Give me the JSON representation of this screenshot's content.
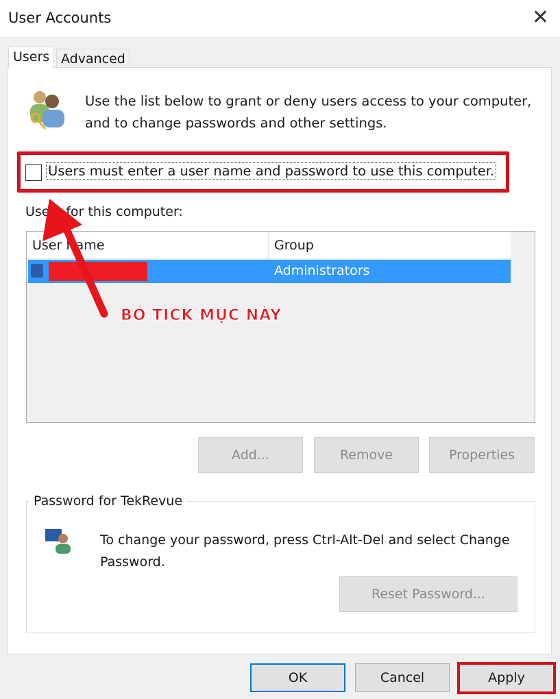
{
  "window": {
    "title": "User Accounts",
    "close_icon": "close-icon"
  },
  "tabs": [
    {
      "label": "Users",
      "active": true
    },
    {
      "label": "Advanced",
      "active": false
    }
  ],
  "intro": {
    "icon": "users-key-icon",
    "text": "Use the list below to grant or deny users access to your computer, and to change passwords and other settings."
  },
  "require_login": {
    "label": "Users must enter a user name and password to use this computer.",
    "checked": false
  },
  "users_list": {
    "label": "Users for this computer:",
    "columns": [
      "User Name",
      "Group"
    ],
    "rows": [
      {
        "name": "",
        "group": "Administrators",
        "selected": true
      }
    ]
  },
  "buttons": {
    "add": "Add...",
    "remove": "Remove",
    "properties": "Properties"
  },
  "password_group": {
    "title": "Password for TekRevue",
    "text": "To change your password, press Ctrl-Alt-Del and select Change Password.",
    "reset": "Reset Password..."
  },
  "footer": {
    "ok": "OK",
    "cancel": "Cancel",
    "apply": "Apply"
  },
  "annotation": {
    "text": "BỎ TICK MỤC NÀY",
    "color": "#e8141c"
  },
  "colors": {
    "selection": "#3399ff",
    "highlight": "#d4101a"
  }
}
